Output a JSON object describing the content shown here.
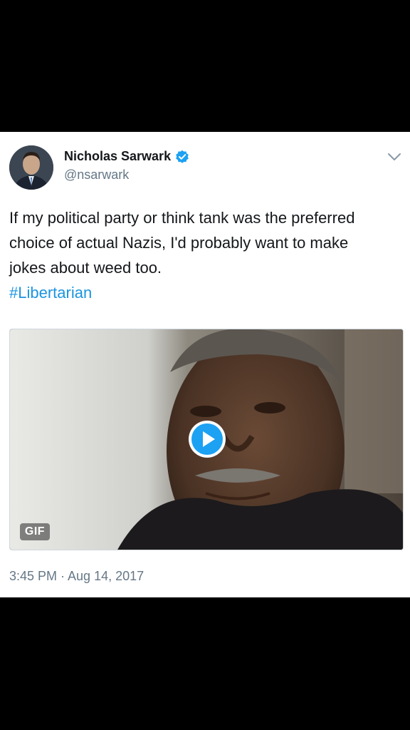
{
  "tweet": {
    "author": {
      "name": "Nicholas Sarwark",
      "handle": "@nsarwark",
      "verified": true,
      "avatar_icon": "profile-photo"
    },
    "text_lines": [
      "If my political party or think tank was the preferred",
      "choice of actual Nazis, I'd probably want to make",
      "jokes about weed too."
    ],
    "hashtag": "#Libertarian",
    "media": {
      "type": "gif",
      "badge": "GIF",
      "play_icon": "play-icon"
    },
    "timestamp": "3:45 PM · Aug 14, 2017",
    "menu_icon": "chevron-down-icon"
  },
  "colors": {
    "background": "#000000",
    "card": "#ffffff",
    "text": "#14171a",
    "secondary": "#657786",
    "link": "#1b95e0",
    "verified": "#1da1f2"
  }
}
